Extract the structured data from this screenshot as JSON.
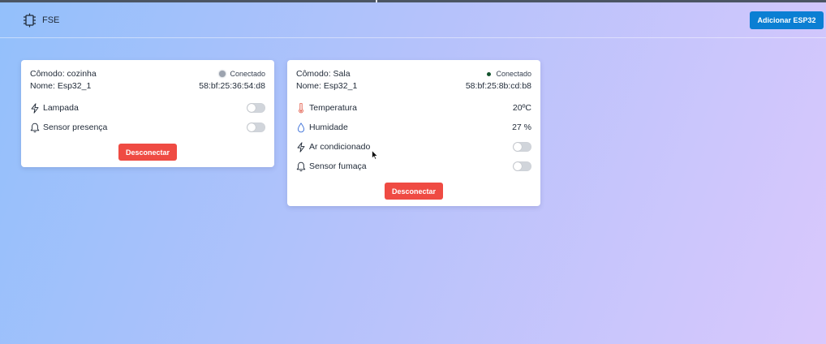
{
  "header": {
    "brand": "FSE",
    "add_button": "Adicionar ESP32"
  },
  "devices": [
    {
      "room": "Cômodo: cozinha",
      "status": "Conectado",
      "name": "Nome: Esp32_1",
      "mac": "58:bf:25:36:54:d8",
      "features": [
        {
          "label": "Lampada",
          "icon": "lightning-icon"
        },
        {
          "label": "Sensor presença",
          "icon": "bell-icon"
        }
      ],
      "disconnect": "Desconectar"
    },
    {
      "room": "Cômodo: Sala",
      "status": "Conectado",
      "name": "Nome: Esp32_1",
      "mac": "58:bf:25:8b:cd:b8",
      "temperature": {
        "label": "Temperatura",
        "value": "20ºC",
        "icon": "thermometer-icon"
      },
      "humidity": {
        "label": "Humidade",
        "value": "27 %",
        "icon": "droplet-icon"
      },
      "features": [
        {
          "label": "Ar condicionado",
          "icon": "lightning-icon"
        },
        {
          "label": "Sensor fumaça",
          "icon": "bell-icon"
        }
      ],
      "disconnect": "Desconectar"
    }
  ],
  "colors": {
    "primary": "#0b7fd3",
    "danger": "#ef4b43",
    "status_dot": "#14532d",
    "temperature_icon": "#e25c4a",
    "humidity_icon": "#3b6fd8"
  }
}
